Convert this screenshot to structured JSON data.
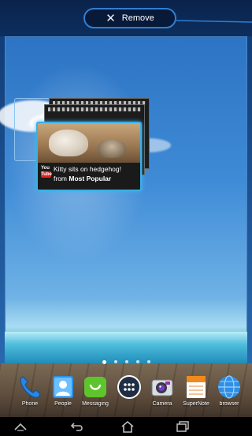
{
  "remove_bar": {
    "label": "Remove",
    "icon": "close-x-icon"
  },
  "widget": {
    "source_logo_top": "You",
    "source_logo_bottom": "Tube",
    "title": "Kitty sits on hedgehog!",
    "source_prefix": "from",
    "source_name": "Most Popular"
  },
  "page_indicator": {
    "total": 5,
    "active": 1
  },
  "dock": {
    "apps": [
      {
        "label": "Phone",
        "icon": "phone-icon"
      },
      {
        "label": "People",
        "icon": "people-icon"
      },
      {
        "label": "Messaging",
        "icon": "messaging-icon"
      },
      {
        "label": "",
        "icon": "all-apps-icon"
      },
      {
        "label": "Camera",
        "icon": "camera-icon"
      },
      {
        "label": "SuperNote",
        "icon": "supernote-icon"
      },
      {
        "label": "browser",
        "icon": "browser-globe-icon"
      }
    ]
  },
  "navbar": {
    "buttons": [
      "collapse-icon",
      "back-icon",
      "home-icon",
      "recent-apps-icon"
    ]
  },
  "colors": {
    "accent": "#2f7fd1",
    "widget_highlight": "#3ab0e8",
    "youtube_red": "#d8231e"
  }
}
